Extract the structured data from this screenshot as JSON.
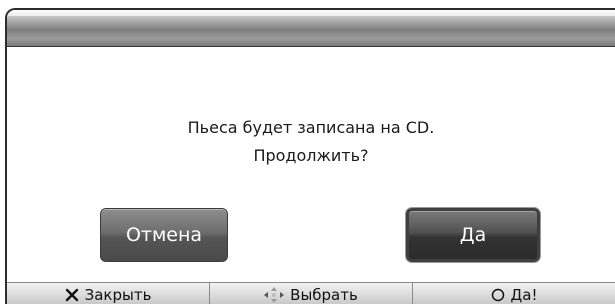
{
  "dialog": {
    "message_line1": "Пьеса будет записана на CD.",
    "message_line2": "Продолжить?"
  },
  "buttons": {
    "cancel_label": "Отмена",
    "yes_label": "Да"
  },
  "footer": {
    "items": [
      {
        "icon": "close-x-icon",
        "label": "Закрыть"
      },
      {
        "icon": "dpad-arrows-icon",
        "label": "Выбрать"
      },
      {
        "icon": "circle-icon",
        "label": "Да!"
      }
    ]
  }
}
